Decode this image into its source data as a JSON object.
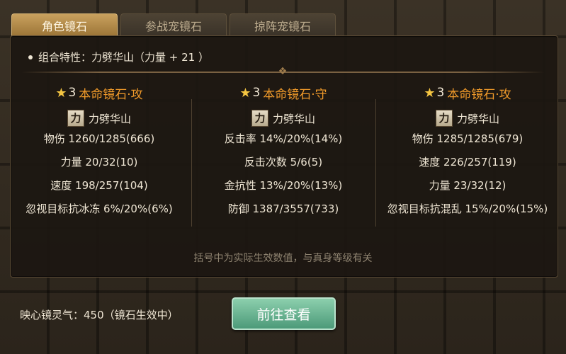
{
  "tabs": [
    {
      "label": "角色镜石"
    },
    {
      "label": "参战宠镜石"
    },
    {
      "label": "掠阵宠镜石"
    }
  ],
  "trait": {
    "text": "组合特性：力劈华山（力量 + 21 ）"
  },
  "stones": [
    {
      "level": "3",
      "name": "本命镜石·攻",
      "skill_icon": "力",
      "skill_name": "力劈华山",
      "stats": [
        "物伤 1260/1285(666)",
        "力量 20/32(10)",
        "速度 198/257(104)",
        "忽视目标抗冰冻 6%/20%(6%)"
      ]
    },
    {
      "level": "3",
      "name": "本命镜石·守",
      "skill_icon": "力",
      "skill_name": "力劈华山",
      "stats": [
        "反击率 14%/20%(14%)",
        "反击次数 5/6(5)",
        "金抗性 13%/20%(13%)",
        "防御 1387/3557(733)"
      ]
    },
    {
      "level": "3",
      "name": "本命镜石·攻",
      "skill_icon": "力",
      "skill_name": "力劈华山",
      "stats": [
        "物伤 1285/1285(679)",
        "速度 226/257(119)",
        "力量 23/32(12)",
        "忽视目标抗混乱 15%/20%(15%)"
      ]
    }
  ],
  "note": "括号中为实际生效数值，与真身等级有关",
  "aura": "映心镜灵气：450（镜石生效中）",
  "button": {
    "label": "前往查看"
  },
  "colors": {
    "accent_orange": "#f09a2a",
    "tab_active": "#c9a15e",
    "button_green": "#6db592"
  }
}
